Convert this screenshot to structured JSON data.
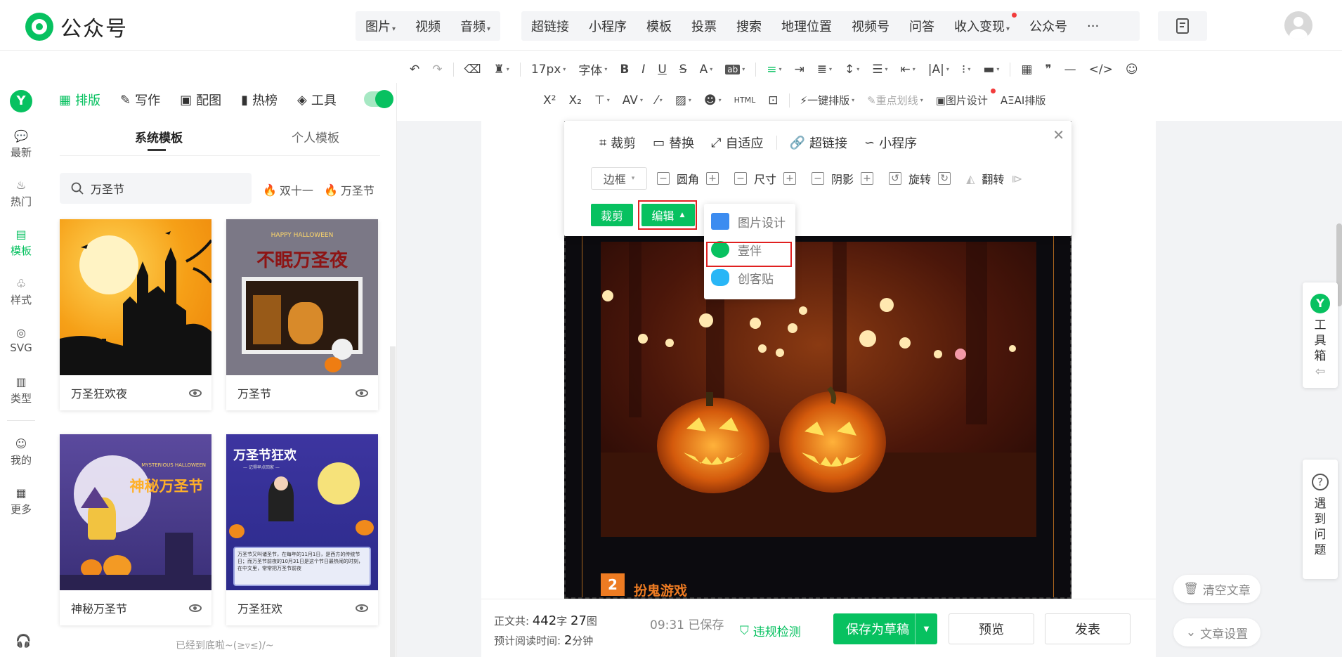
{
  "app": {
    "title": "公众号"
  },
  "nav": {
    "group1": [
      {
        "label": "图片",
        "caret": true
      },
      {
        "label": "视频",
        "caret": false
      },
      {
        "label": "音频",
        "caret": true
      }
    ],
    "group2": [
      {
        "label": "超链接",
        "dot": false
      },
      {
        "label": "小程序",
        "dot": false
      },
      {
        "label": "模板",
        "dot": false
      },
      {
        "label": "投票",
        "dot": false
      },
      {
        "label": "搜索",
        "dot": false
      },
      {
        "label": "地理位置",
        "dot": false
      },
      {
        "label": "视频号",
        "dot": false
      },
      {
        "label": "问答",
        "dot": false
      },
      {
        "label": "收入变现",
        "dot": true
      },
      {
        "label": "公众号",
        "dot": false
      },
      {
        "label": "···",
        "dot": false
      }
    ]
  },
  "format_toolbar": {
    "font_size": "17px",
    "font_family": "字体",
    "one_click_layout": "一键排版",
    "highlight": "重点划线",
    "image_design": "图片设计",
    "ai_layout": "AI排版"
  },
  "rail": {
    "logo": "Y",
    "items": [
      {
        "label": "最新",
        "icon": "💬"
      },
      {
        "label": "热门",
        "icon": "♨"
      },
      {
        "label": "模板",
        "icon": "▤"
      },
      {
        "label": "样式",
        "icon": "♧"
      },
      {
        "label": "SVG",
        "icon": "◎"
      },
      {
        "label": "类型",
        "icon": "▥"
      },
      {
        "label": "我的",
        "icon": "☺"
      },
      {
        "label": "更多",
        "icon": "▦"
      }
    ],
    "support_icon": "🎧"
  },
  "panel": {
    "tabs": [
      {
        "label": "排版",
        "icon": "▦"
      },
      {
        "label": "写作",
        "icon": "✎"
      },
      {
        "label": "配图",
        "icon": "▣"
      },
      {
        "label": "热榜",
        "icon": "▮"
      },
      {
        "label": "工具",
        "icon": "◈"
      }
    ],
    "sub_tabs": [
      "系统模板",
      "个人模板"
    ],
    "search_value": "万圣节",
    "hot_tags": [
      "双十一",
      "万圣节"
    ],
    "cards": [
      {
        "title": "万圣狂欢夜"
      },
      {
        "title": "万圣节"
      },
      {
        "title": "神秘万圣节"
      },
      {
        "title": "万圣狂欢"
      }
    ],
    "card2_banner": "不眠万圣夜",
    "card2_small": "HAPPY HALLOWEEN",
    "card3_banner": "神秘万圣节",
    "card3_small": "MYSTERIOUS HALLOWEEN",
    "card4_banner": "万圣节狂欢",
    "card4_sub": "— 记得早点回家 —",
    "card4_text": "万圣节又叫诸圣节，在每年的11月1日，是西方的传统节日；而万圣节前夜的10月31日是这个节日最热闹的时刻，在中文里，常常把万圣节前夜",
    "end_note": "已经到底啦~(≥▿≤)/~"
  },
  "image_toolbar": {
    "row1": [
      {
        "label": "裁剪",
        "icon": "⌗"
      },
      {
        "label": "替换",
        "icon": "▭"
      },
      {
        "label": "自适应",
        "icon": "⤢"
      },
      {
        "label": "超链接",
        "icon": "🔗"
      },
      {
        "label": "小程序",
        "icon": "∽"
      }
    ],
    "border_label": "边框",
    "controls": [
      "圆角",
      "尺寸",
      "阴影",
      "旋转",
      "翻转"
    ],
    "crop_btn": "裁剪",
    "edit_btn": "编辑",
    "dropdown": [
      "图片设计",
      "壹伴",
      "创客贴"
    ]
  },
  "article": {
    "section_number": "2",
    "section_title": "扮鬼游戏"
  },
  "right_float": {
    "toolbox_logo": "Y",
    "toolbox_label": [
      "工",
      "具",
      "箱"
    ],
    "help_label": [
      "遇",
      "到",
      "问",
      "题"
    ],
    "clear_label": "清空文章",
    "settings_label": "文章设置"
  },
  "bottom": {
    "word_label": "正文共:",
    "word_count": "442",
    "word_unit": "字",
    "image_count": "27",
    "image_unit": "图",
    "read_label": "预计阅读时间:",
    "read_time": "2",
    "read_unit": "分钟",
    "saved": "09:31  已保存",
    "violation": "违规检测",
    "save_draft": "保存为草稿",
    "preview": "预览",
    "publish": "发表"
  }
}
